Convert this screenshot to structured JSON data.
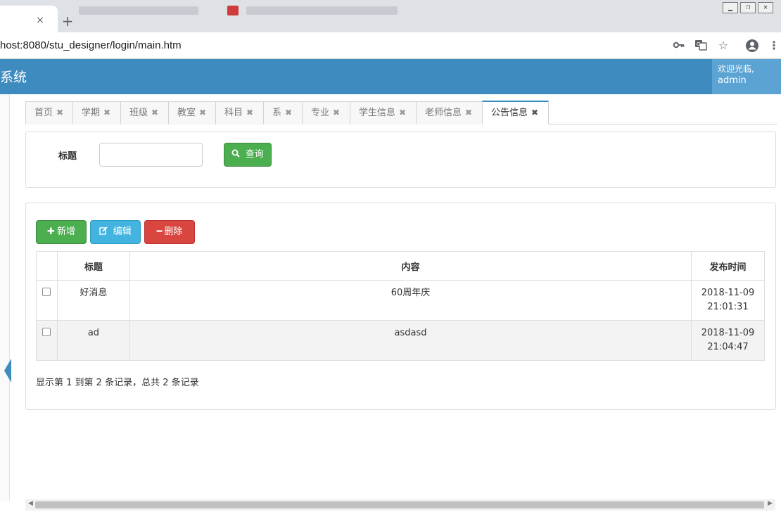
{
  "browser": {
    "tab_close": "×",
    "new_tab": "+",
    "url": "host:8080/stu_designer/login/main.htm",
    "window_controls": [
      "▁",
      "❐",
      "✕"
    ]
  },
  "app": {
    "title": "系统",
    "welcome_line": "欢迎光临,",
    "username": "admin"
  },
  "tabs": [
    {
      "label": "首页",
      "close": "✖"
    },
    {
      "label": "学期",
      "close": "✖"
    },
    {
      "label": "班级",
      "close": "✖"
    },
    {
      "label": "教室",
      "close": "✖"
    },
    {
      "label": "科目",
      "close": "✖"
    },
    {
      "label": "系",
      "close": "✖"
    },
    {
      "label": "专业",
      "close": "✖"
    },
    {
      "label": "学生信息",
      "close": "✖"
    },
    {
      "label": "老师信息",
      "close": "✖"
    },
    {
      "label": "公告信息",
      "close": "✖"
    }
  ],
  "search": {
    "title_label": "标题",
    "title_value": "",
    "search_button": "查询"
  },
  "toolbar": {
    "add_button": "新增",
    "edit_button": "编辑",
    "delete_button": "删除"
  },
  "table": {
    "columns": [
      "标题",
      "内容",
      "发布时间"
    ],
    "rows": [
      {
        "title": "好消息",
        "content": "60周年庆",
        "date": "2018-11-09",
        "time": "21:01:31"
      },
      {
        "title": "ad",
        "content": "asdasd",
        "date": "2018-11-09",
        "time": "21:04:47"
      }
    ]
  },
  "pagination": {
    "summary": "显示第 1 到第 2 条记录，总共 2 条记录"
  },
  "colors": {
    "header": "#3e8bbf",
    "success": "#4bae4f",
    "info": "#43b4e0",
    "danger": "#d9453f"
  },
  "icons": {
    "search": "search-icon",
    "add": "plus-icon",
    "edit": "edit-icon",
    "delete": "minus-icon"
  }
}
